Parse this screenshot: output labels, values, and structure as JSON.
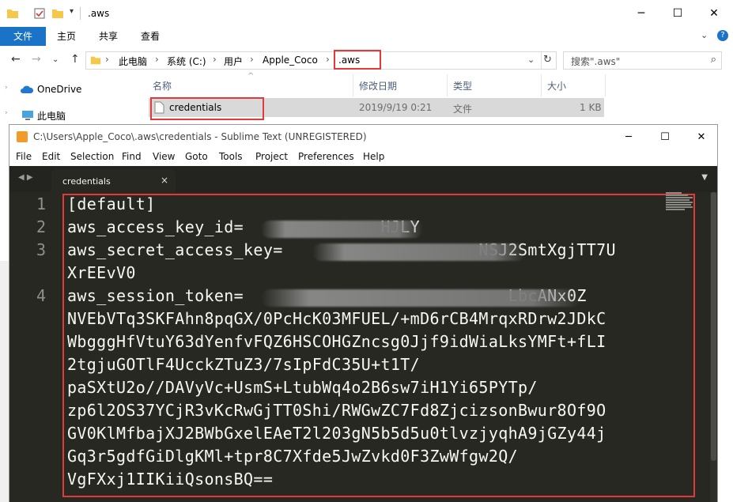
{
  "explorer": {
    "title": ".aws",
    "ribbon_tabs": [
      "文件",
      "主页",
      "共享",
      "查看"
    ],
    "breadcrumb": [
      "此电脑",
      "系统 (C:)",
      "用户",
      "Apple_Coco",
      ".aws"
    ],
    "search_placeholder": "搜索\".aws\"",
    "nav": {
      "onedrive": "OneDrive",
      "this_pc": "此电脑"
    },
    "columns": {
      "name": "名称",
      "modified": "修改日期",
      "type": "类型",
      "size": "大小"
    },
    "file": {
      "name": "credentials",
      "modified": "2019/9/19 0:21",
      "type": "文件",
      "size": "1 KB"
    },
    "highlight_color": "#e03a3a",
    "ribbon_file_color": "#1a73c6"
  },
  "sublime": {
    "title": "C:\\Users\\Apple_Coco\\.aws\\credentials - Sublime Text (UNREGISTERED)",
    "menu": [
      "File",
      "Edit",
      "Selection",
      "Find",
      "View",
      "Goto",
      "Tools",
      "Project",
      "Preferences",
      "Help"
    ],
    "tab_label": "credentials",
    "tab_close": "×",
    "line_numbers": [
      "1",
      "2",
      "3",
      "4"
    ],
    "code_lines": [
      "[default]",
      "aws_access_key_id=              HJLY",
      "aws_secret_access_key=                    NSJ2SmtXgjTT7U",
      "XrEEvV0",
      "aws_session_token=                           LbcANx0Z",
      "NVEbVTq3SKFAhn8pqGX/0PcHcK03MFUEL/+mD6rCB4MrqxRDrw2JDkC",
      "WbgggHfVtuY63dYenfvFQZ6HSCOHGZncsg0Jjf9idWiaLksYMFt+fLI",
      "2tgjuGOTlF4UcckZTuZ3/7sIpFdC35U+t1T/",
      "paSXtU2o//DAVyVc+UsmS+LtubWq4o2B6sw7iH1Yi65PYTp/",
      "zp6l2OS37YCjR3vKcRwGjTT0Shi/RWGwZC7Fd8ZjcizsonBwur8Of9O",
      "GV0KlMfbajXJ2BWbGxelEAeT2l203gN5b5d5u0tlvzjyqhA9jGZy44j",
      "Gq3r5gdfGiDlgKMl+tpr8C7Xfde5JwZvkd0F3ZwWfgw2Q/",
      "VgFXxj1IIKiiQsonsBQ=="
    ],
    "editor_bg": "#272822",
    "text_color": "#f8f8f2"
  }
}
